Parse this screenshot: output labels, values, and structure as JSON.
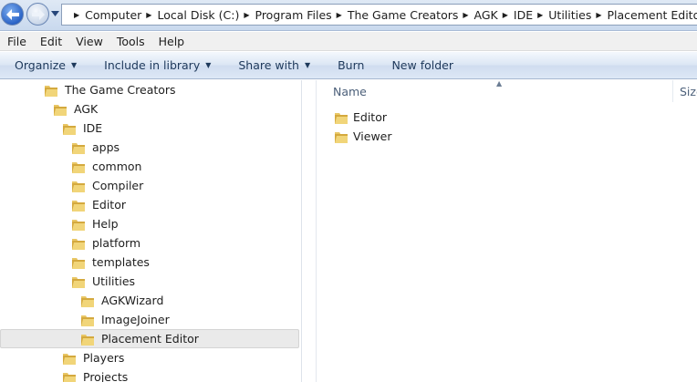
{
  "breadcrumb": [
    "Computer",
    "Local Disk (C:)",
    "Program Files",
    "The Game Creators",
    "AGK",
    "IDE",
    "Utilities",
    "Placement Editor"
  ],
  "menu": [
    "File",
    "Edit",
    "View",
    "Tools",
    "Help"
  ],
  "commands": {
    "organize": "Organize",
    "include_in_library": "Include in library",
    "share_with": "Share with",
    "burn": "Burn",
    "new_folder": "New folder"
  },
  "tree": [
    {
      "label": "The Game Creators",
      "depth": 0
    },
    {
      "label": "AGK",
      "depth": 1
    },
    {
      "label": "IDE",
      "depth": 2
    },
    {
      "label": "apps",
      "depth": 3
    },
    {
      "label": "common",
      "depth": 3
    },
    {
      "label": "Compiler",
      "depth": 3
    },
    {
      "label": "Editor",
      "depth": 3
    },
    {
      "label": "Help",
      "depth": 3
    },
    {
      "label": "platform",
      "depth": 3
    },
    {
      "label": "templates",
      "depth": 3
    },
    {
      "label": "Utilities",
      "depth": 3
    },
    {
      "label": "AGKWizard",
      "depth": 4
    },
    {
      "label": "ImageJoiner",
      "depth": 4
    },
    {
      "label": "Placement Editor",
      "depth": 4,
      "selected": true
    },
    {
      "label": "Players",
      "depth": 2
    },
    {
      "label": "Projects",
      "depth": 2
    }
  ],
  "columns": {
    "name": "Name",
    "size": "Size"
  },
  "files": [
    "Editor",
    "Viewer"
  ],
  "colors": {
    "folder": "#e8c55a",
    "selection": "#eaeaea",
    "accent": "#2a63c6"
  }
}
